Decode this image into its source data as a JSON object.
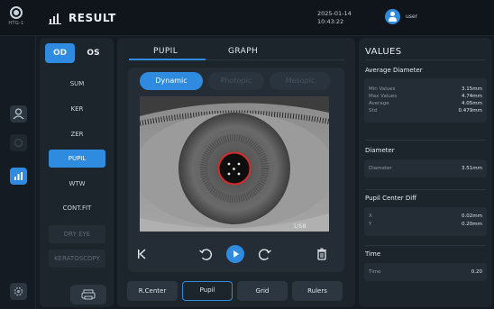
{
  "header": {
    "brand": "HTG-1",
    "title": "RESULT",
    "date": "2025-01-14",
    "time": "10:43:22",
    "user": "user"
  },
  "colors": {
    "accent": "#2e8be0",
    "pupil_ring": "#d62b2b"
  },
  "eye_toggle": {
    "od": "OD",
    "os": "OS",
    "selected": "OD"
  },
  "menu": [
    {
      "label": "SUM",
      "state": "normal"
    },
    {
      "label": "KER",
      "state": "normal"
    },
    {
      "label": "ZER",
      "state": "normal"
    },
    {
      "label": "PUPIL",
      "state": "active"
    },
    {
      "label": "WTW",
      "state": "normal"
    },
    {
      "label": "CONT.FIT",
      "state": "normal"
    },
    {
      "label": "DRY EYE",
      "state": "disabled"
    },
    {
      "label": "KERATOSCOPY",
      "state": "disabled"
    }
  ],
  "tabs": {
    "pupil": "PUPIL",
    "graph": "GRAPH"
  },
  "modes": {
    "dynamic": "Dynamic",
    "photopic": "Photopic",
    "mesopic": "Mesopic"
  },
  "viewer": {
    "counter": "1/58"
  },
  "bottom_tabs": [
    {
      "label": "R.Center",
      "active": false
    },
    {
      "label": "Pupil",
      "active": true
    },
    {
      "label": "Grid",
      "active": false
    },
    {
      "label": "Rulers",
      "active": false
    }
  ],
  "values": {
    "title": "VALUES",
    "average_diameter": {
      "title": "Average Diameter",
      "rows": [
        {
          "k": "Min Values",
          "v": "3.15mm"
        },
        {
          "k": "Max Values",
          "v": "4.74mm"
        },
        {
          "k": "Average",
          "v": "4.05mm"
        },
        {
          "k": "Std",
          "v": "0.479mm"
        }
      ]
    },
    "diameter": {
      "title": "Diameter",
      "rows": [
        {
          "k": "Diameter",
          "v": "3.51mm"
        }
      ]
    },
    "pupil_center_diff": {
      "title": "Pupil Center Diff",
      "rows": [
        {
          "k": "X",
          "v": "0.02mm"
        },
        {
          "k": "Y",
          "v": "0.20mm"
        }
      ]
    },
    "time": {
      "title": "Time",
      "rows": [
        {
          "k": "Time",
          "v": "0.20"
        }
      ]
    }
  }
}
